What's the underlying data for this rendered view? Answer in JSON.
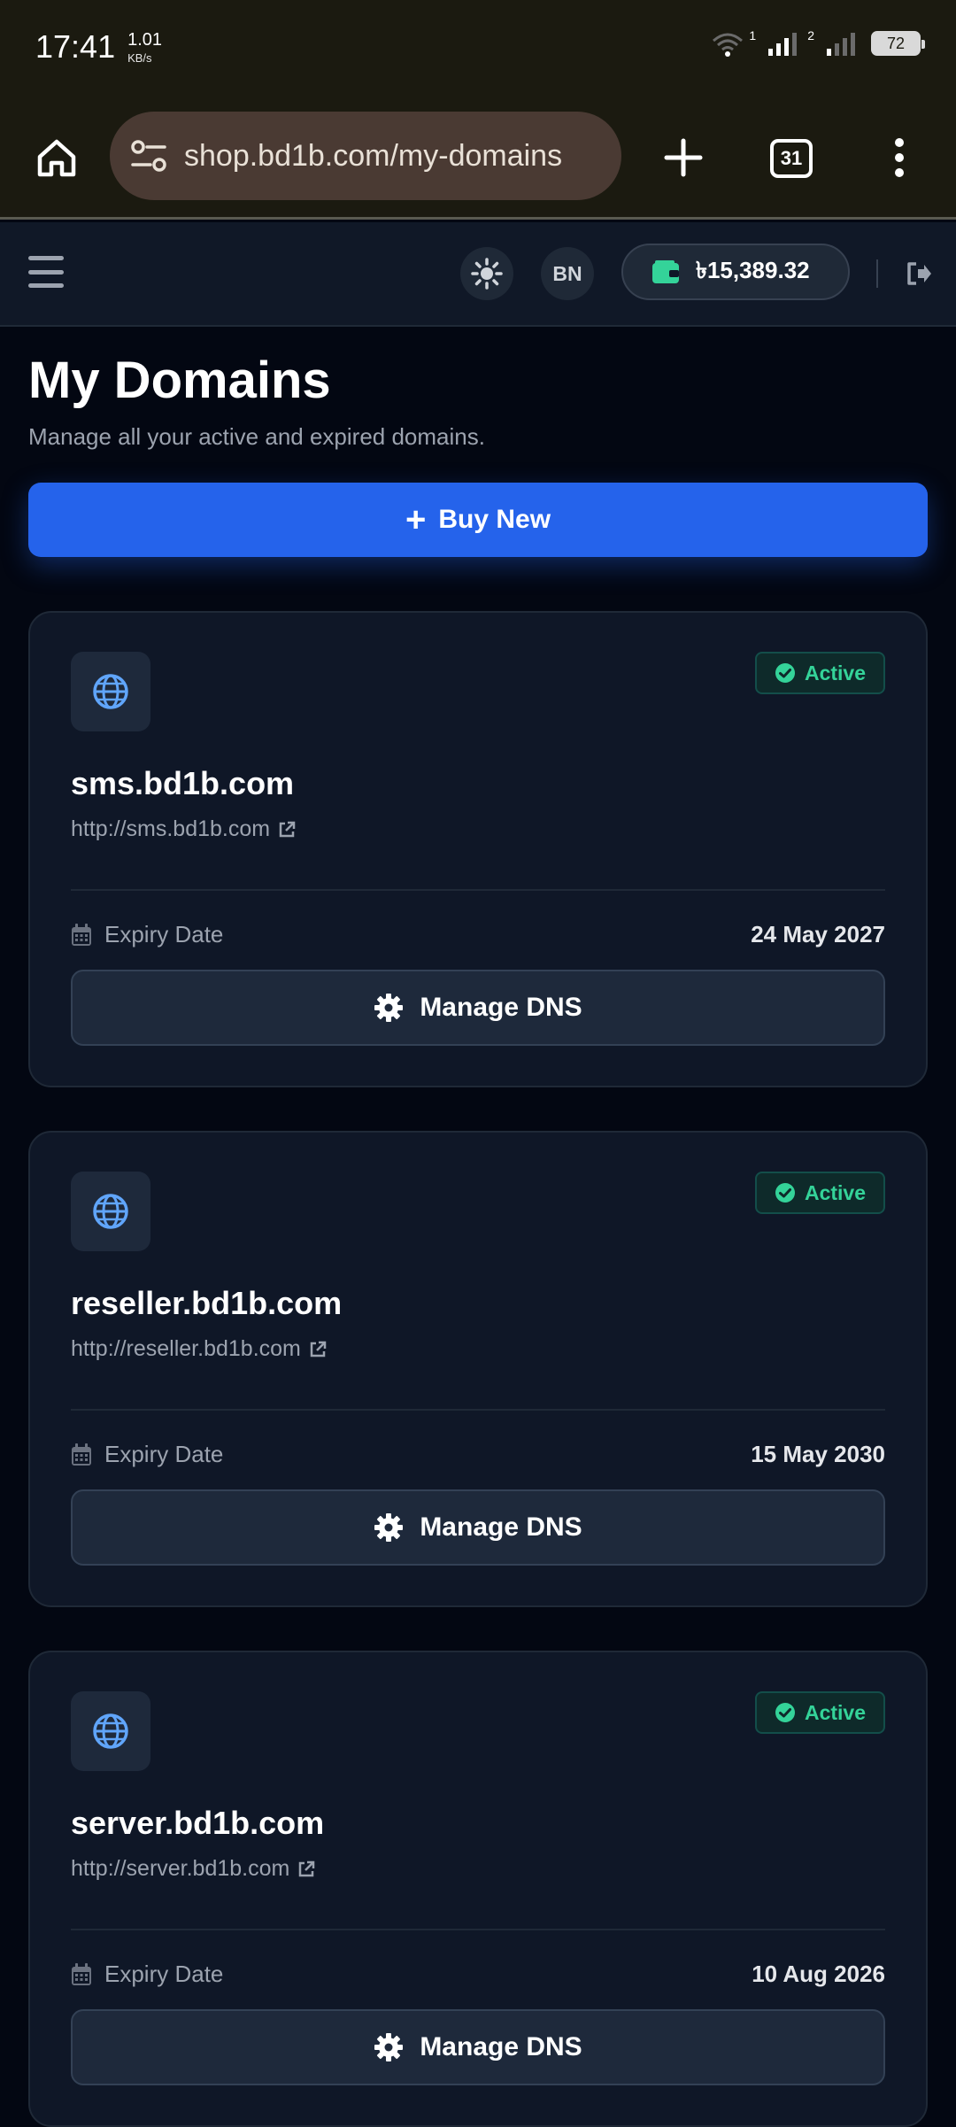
{
  "status_bar": {
    "time": "17:41",
    "speed_value": "1.01",
    "speed_unit": "KB/s",
    "sim1_label": "1",
    "sim2_label": "2",
    "battery": "72"
  },
  "browser": {
    "url": "shop.bd1b.com/my-domains",
    "tab_count": "31"
  },
  "header": {
    "language": "BN",
    "wallet_balance": "৳15,389.32"
  },
  "page": {
    "title": "My Domains",
    "subtitle": "Manage all your active and expired domains.",
    "buy_plus": "+",
    "buy_label": "Buy New"
  },
  "domains": [
    {
      "name": "sms.bd1b.com",
      "url": "http://sms.bd1b.com",
      "status": "Active",
      "expiry_label": "Expiry Date",
      "expiry_date": "24 May 2027",
      "manage_label": "Manage DNS"
    },
    {
      "name": "reseller.bd1b.com",
      "url": "http://reseller.bd1b.com",
      "status": "Active",
      "expiry_label": "Expiry Date",
      "expiry_date": "15 May 2030",
      "manage_label": "Manage DNS"
    },
    {
      "name": "server.bd1b.com",
      "url": "http://server.bd1b.com",
      "status": "Active",
      "expiry_label": "Expiry Date",
      "expiry_date": "10 Aug 2026",
      "manage_label": "Manage DNS"
    }
  ],
  "colors": {
    "background": "#030712",
    "card": "#0f1727",
    "accent": "#2563eb",
    "active": "#34d399",
    "globe": "#60a5fa",
    "wallet_icon": "#34d399"
  },
  "icons": {
    "home": "home-icon",
    "site_settings": "tune-icon",
    "new_tab": "plus-icon",
    "menu": "more-vertical-icon",
    "hamburger": "hamburger-icon",
    "theme": "sun-icon",
    "wallet": "wallet-icon",
    "logout": "logout-icon",
    "globe": "globe-icon",
    "status": "check-circle-icon",
    "external": "external-link-icon",
    "calendar": "calendar-icon",
    "gear": "gear-icon"
  }
}
